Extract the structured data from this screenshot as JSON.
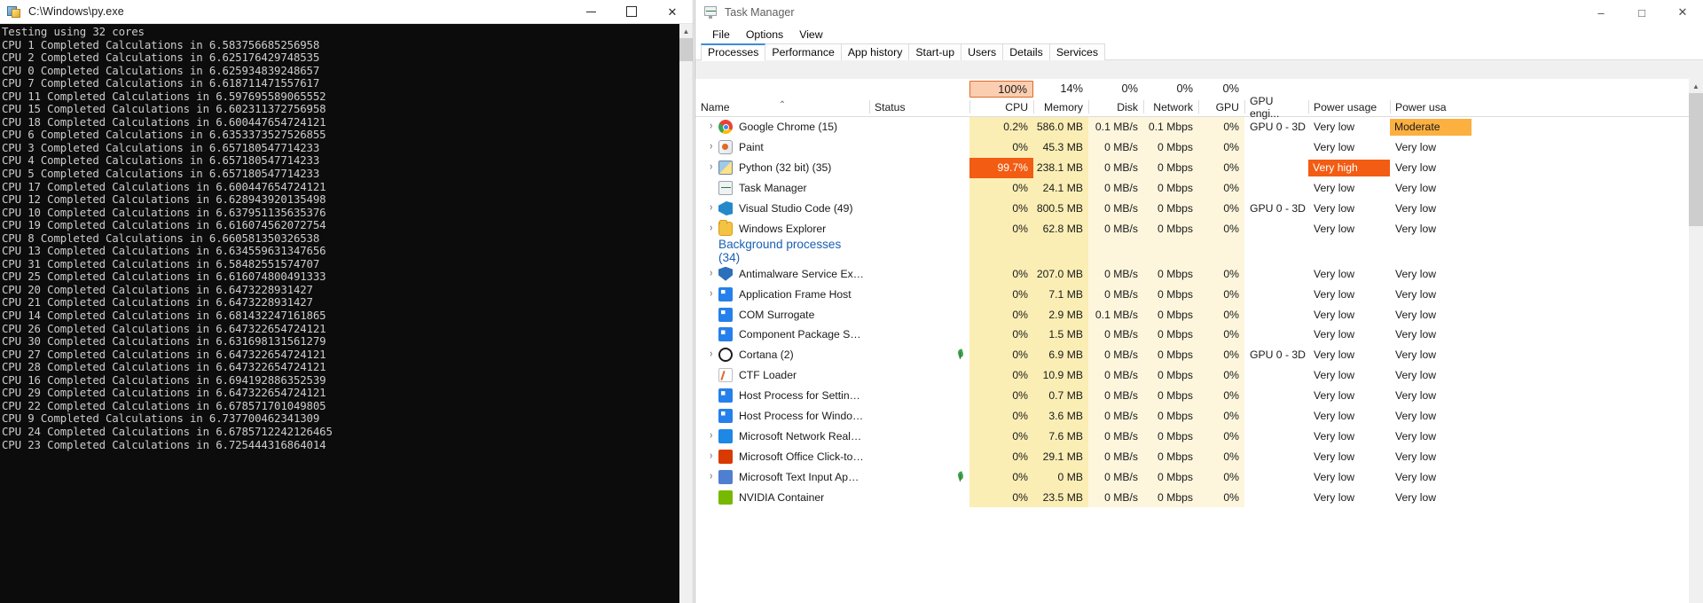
{
  "console": {
    "title": "C:\\Windows\\py.exe",
    "window_buttons": {
      "minimize": "–",
      "maximize": "□",
      "close": "✕"
    },
    "lines": [
      "Testing using 32 cores",
      "CPU 1 Completed Calculations in 6.583756685256958",
      "CPU 2 Completed Calculations in 6.625176429748535",
      "CPU 0 Completed Calculations in 6.625934839248657",
      "CPU 7 Completed Calculations in 6.618711471557617",
      "CPU 11 Completed Calculations in 6.597695589065552",
      "CPU 15 Completed Calculations in 6.602311372756958",
      "CPU 18 Completed Calculations in 6.600447654724121",
      "CPU 6 Completed Calculations in 6.6353373527526855",
      "CPU 3 Completed Calculations in 6.657180547714233",
      "CPU 4 Completed Calculations in 6.657180547714233",
      "CPU 5 Completed Calculations in 6.657180547714233",
      "CPU 17 Completed Calculations in 6.600447654724121",
      "CPU 12 Completed Calculations in 6.628943920135498",
      "CPU 10 Completed Calculations in 6.637951135635376",
      "CPU 19 Completed Calculations in 6.616074562072754",
      "CPU 8 Completed Calculations in 6.660581350326538",
      "CPU 13 Completed Calculations in 6.634559631347656",
      "CPU 31 Completed Calculations in 6.58482551574707",
      "CPU 25 Completed Calculations in 6.616074800491333",
      "CPU 20 Completed Calculations in 6.6473228931427",
      "CPU 21 Completed Calculations in 6.6473228931427",
      "CPU 14 Completed Calculations in 6.681432247161865",
      "CPU 26 Completed Calculations in 6.647322654724121",
      "CPU 30 Completed Calculations in 6.631698131561279",
      "CPU 27 Completed Calculations in 6.647322654724121",
      "CPU 28 Completed Calculations in 6.647322654724121",
      "CPU 16 Completed Calculations in 6.694192886352539",
      "CPU 29 Completed Calculations in 6.647322654724121",
      "CPU 22 Completed Calculations in 6.678571701049805",
      "CPU 9 Completed Calculations in 6.737700462341309",
      "CPU 24 Completed Calculations in 6.6785712242126465",
      "CPU 23 Completed Calculations in 6.725444316864014"
    ]
  },
  "taskmanager": {
    "title": "Task Manager",
    "window_buttons": {
      "minimize": "–",
      "maximize": "□",
      "close": "✕"
    },
    "menu": [
      "File",
      "Options",
      "View"
    ],
    "tabs": [
      {
        "label": "Processes",
        "active": true
      },
      {
        "label": "Performance",
        "active": false
      },
      {
        "label": "App history",
        "active": false
      },
      {
        "label": "Start-up",
        "active": false
      },
      {
        "label": "Users",
        "active": false
      },
      {
        "label": "Details",
        "active": false
      },
      {
        "label": "Services",
        "active": false
      }
    ],
    "columns": [
      {
        "key": "name",
        "label": "Name",
        "pct": "",
        "hot": false,
        "sorted": true
      },
      {
        "key": "status",
        "label": "Status",
        "pct": "",
        "hot": false,
        "sorted": false
      },
      {
        "key": "cpu",
        "label": "CPU",
        "pct": "100%",
        "hot": true,
        "sorted": false
      },
      {
        "key": "memory",
        "label": "Memory",
        "pct": "14%",
        "hot": false,
        "sorted": false
      },
      {
        "key": "disk",
        "label": "Disk",
        "pct": "0%",
        "hot": false,
        "sorted": false
      },
      {
        "key": "network",
        "label": "Network",
        "pct": "0%",
        "hot": false,
        "sorted": false
      },
      {
        "key": "gpu",
        "label": "GPU",
        "pct": "0%",
        "hot": false,
        "sorted": false
      },
      {
        "key": "gpueng",
        "label": "GPU engi...",
        "pct": "",
        "hot": false,
        "sorted": false
      },
      {
        "key": "power",
        "label": "Power usage",
        "pct": "",
        "hot": false,
        "sorted": false
      },
      {
        "key": "power2",
        "label": "Power usa",
        "pct": "",
        "hot": false,
        "sorted": false
      }
    ],
    "group_header": "Background processes (34)",
    "apps": [
      {
        "name": "Google Chrome (15)",
        "icon": "chrome-icon",
        "expandable": true,
        "leaf": false,
        "status": "",
        "cpu": "0.2%",
        "cpu_level": "low",
        "memory": "586.0 MB",
        "disk": "0.1 MB/s",
        "network": "0.1 Mbps",
        "gpu": "0%",
        "gpueng": "GPU 0 - 3D",
        "power": "Very low",
        "power2": "Moderate",
        "power2_badge": "moderate"
      },
      {
        "name": "Paint",
        "icon": "paint-icon",
        "expandable": true,
        "leaf": false,
        "status": "",
        "cpu": "0%",
        "cpu_level": "low",
        "memory": "45.3 MB",
        "disk": "0 MB/s",
        "network": "0 Mbps",
        "gpu": "0%",
        "gpueng": "",
        "power": "Very low",
        "power2": "Very low",
        "power2_badge": ""
      },
      {
        "name": "Python (32 bit) (35)",
        "icon": "python-icon",
        "expandable": true,
        "leaf": false,
        "status": "",
        "cpu": "99.7%",
        "cpu_level": "high",
        "memory": "238.1 MB",
        "disk": "0 MB/s",
        "network": "0 Mbps",
        "gpu": "0%",
        "gpueng": "",
        "power": "Very high",
        "power_badge": "veryhigh",
        "power2": "Very low",
        "power2_badge": ""
      },
      {
        "name": "Task Manager",
        "icon": "taskmgr-icon",
        "expandable": false,
        "leaf": false,
        "status": "",
        "cpu": "0%",
        "cpu_level": "low",
        "memory": "24.1 MB",
        "disk": "0 MB/s",
        "network": "0 Mbps",
        "gpu": "0%",
        "gpueng": "",
        "power": "Very low",
        "power2": "Very low",
        "power2_badge": ""
      },
      {
        "name": "Visual Studio Code (49)",
        "icon": "vscode-icon",
        "expandable": true,
        "leaf": false,
        "status": "",
        "cpu": "0%",
        "cpu_level": "low",
        "memory": "800.5 MB",
        "disk": "0 MB/s",
        "network": "0 Mbps",
        "gpu": "0%",
        "gpueng": "GPU 0 - 3D",
        "power": "Very low",
        "power2": "Very low",
        "power2_badge": ""
      },
      {
        "name": "Windows Explorer",
        "icon": "folder-icon",
        "expandable": true,
        "leaf": false,
        "status": "",
        "cpu": "0%",
        "cpu_level": "low",
        "memory": "62.8 MB",
        "disk": "0 MB/s",
        "network": "0 Mbps",
        "gpu": "0%",
        "gpueng": "",
        "power": "Very low",
        "power2": "Very low",
        "power2_badge": ""
      }
    ],
    "background": [
      {
        "name": "Antimalware Service Executable",
        "icon": "shield-icon",
        "expandable": true,
        "leaf": false,
        "status": "",
        "cpu": "0%",
        "cpu_level": "low",
        "memory": "207.0 MB",
        "disk": "0 MB/s",
        "network": "0 Mbps",
        "gpu": "0%",
        "gpueng": "",
        "power": "Very low",
        "power2": "Very low"
      },
      {
        "name": "Application Frame Host",
        "icon": "window-icon",
        "expandable": true,
        "leaf": false,
        "status": "",
        "cpu": "0%",
        "cpu_level": "low",
        "memory": "7.1 MB",
        "disk": "0 MB/s",
        "network": "0 Mbps",
        "gpu": "0%",
        "gpueng": "",
        "power": "Very low",
        "power2": "Very low"
      },
      {
        "name": "COM Surrogate",
        "icon": "window-icon",
        "expandable": false,
        "leaf": false,
        "status": "",
        "cpu": "0%",
        "cpu_level": "low",
        "memory": "2.9 MB",
        "disk": "0.1 MB/s",
        "network": "0 Mbps",
        "gpu": "0%",
        "gpueng": "",
        "power": "Very low",
        "power2": "Very low"
      },
      {
        "name": "Component Package Support S...",
        "icon": "window-icon",
        "expandable": false,
        "leaf": false,
        "status": "",
        "cpu": "0%",
        "cpu_level": "low",
        "memory": "1.5 MB",
        "disk": "0 MB/s",
        "network": "0 Mbps",
        "gpu": "0%",
        "gpueng": "",
        "power": "Very low",
        "power2": "Very low"
      },
      {
        "name": "Cortana (2)",
        "icon": "cortana-icon",
        "expandable": true,
        "leaf": true,
        "status": "",
        "cpu": "0%",
        "cpu_level": "low",
        "memory": "6.9 MB",
        "disk": "0 MB/s",
        "network": "0 Mbps",
        "gpu": "0%",
        "gpueng": "GPU 0 - 3D",
        "power": "Very low",
        "power2": "Very low"
      },
      {
        "name": "CTF Loader",
        "icon": "ctf-icon",
        "expandable": false,
        "leaf": false,
        "status": "",
        "cpu": "0%",
        "cpu_level": "low",
        "memory": "10.9 MB",
        "disk": "0 MB/s",
        "network": "0 Mbps",
        "gpu": "0%",
        "gpueng": "",
        "power": "Very low",
        "power2": "Very low"
      },
      {
        "name": "Host Process for Setting Synchr...",
        "icon": "window-icon",
        "expandable": false,
        "leaf": false,
        "status": "",
        "cpu": "0%",
        "cpu_level": "low",
        "memory": "0.7 MB",
        "disk": "0 MB/s",
        "network": "0 Mbps",
        "gpu": "0%",
        "gpueng": "",
        "power": "Very low",
        "power2": "Very low"
      },
      {
        "name": "Host Process for Windows Tasks",
        "icon": "window-icon",
        "expandable": false,
        "leaf": false,
        "status": "",
        "cpu": "0%",
        "cpu_level": "low",
        "memory": "3.6 MB",
        "disk": "0 MB/s",
        "network": "0 Mbps",
        "gpu": "0%",
        "gpueng": "",
        "power": "Very low",
        "power2": "Very low"
      },
      {
        "name": "Microsoft Network Realtime Ins...",
        "icon": "network-icon",
        "expandable": true,
        "leaf": false,
        "status": "",
        "cpu": "0%",
        "cpu_level": "low",
        "memory": "7.6 MB",
        "disk": "0 MB/s",
        "network": "0 Mbps",
        "gpu": "0%",
        "gpueng": "",
        "power": "Very low",
        "power2": "Very low"
      },
      {
        "name": "Microsoft Office Click-to-Run (...",
        "icon": "office-icon",
        "expandable": true,
        "leaf": false,
        "status": "",
        "cpu": "0%",
        "cpu_level": "low",
        "memory": "29.1 MB",
        "disk": "0 MB/s",
        "network": "0 Mbps",
        "gpu": "0%",
        "gpueng": "",
        "power": "Very low",
        "power2": "Very low"
      },
      {
        "name": "Microsoft Text Input Application",
        "icon": "text-icon",
        "expandable": true,
        "leaf": true,
        "status": "",
        "cpu": "0%",
        "cpu_level": "low",
        "memory": "0 MB",
        "disk": "0 MB/s",
        "network": "0 Mbps",
        "gpu": "0%",
        "gpueng": "",
        "power": "Very low",
        "power2": "Very low"
      },
      {
        "name": "NVIDIA Container",
        "icon": "nvidia-icon",
        "expandable": false,
        "leaf": false,
        "status": "",
        "cpu": "0%",
        "cpu_level": "low",
        "memory": "23.5 MB",
        "disk": "0 MB/s",
        "network": "0 Mbps",
        "gpu": "0%",
        "gpueng": "",
        "power": "Very low",
        "power2": "Very low"
      }
    ]
  },
  "colors": {
    "cpu_hot": "#f25c13",
    "cpu_header_hot_bg": "#fbceb1",
    "cpu_header_hot_border": "#e06a28",
    "heat_light": "#fdf6dd",
    "heat_mid": "#fbeeb5",
    "link_blue": "#1a5fb4",
    "moderate": "#fbb040"
  }
}
